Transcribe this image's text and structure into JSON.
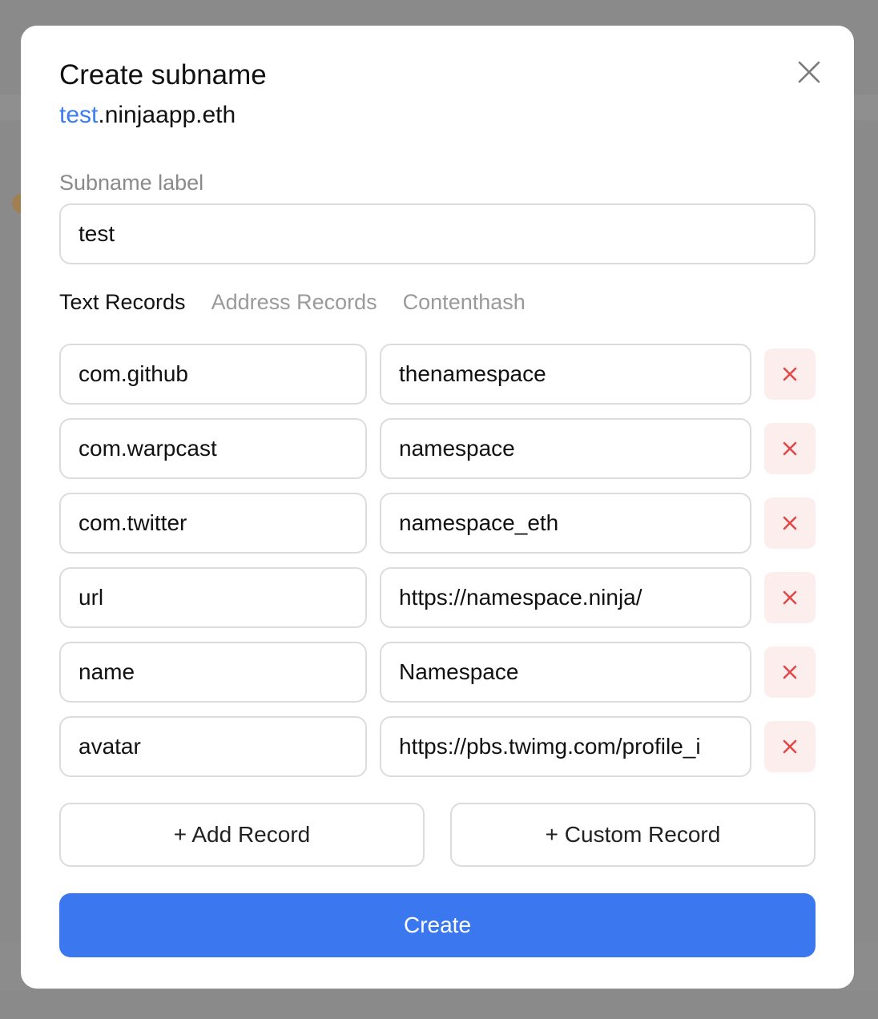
{
  "modal": {
    "title": "Create subname",
    "subtitle_label": "test",
    "subtitle_domain": ".ninjaapp.eth"
  },
  "subname": {
    "field_label": "Subname label",
    "value": "test"
  },
  "tabs": [
    {
      "label": "Text Records",
      "active": true
    },
    {
      "label": "Address Records",
      "active": false
    },
    {
      "label": "Contenthash",
      "active": false
    }
  ],
  "records": [
    {
      "key": "com.github",
      "value": "thenamespace"
    },
    {
      "key": "com.warpcast",
      "value": "namespace"
    },
    {
      "key": "com.twitter",
      "value": "namespace_eth"
    },
    {
      "key": "url",
      "value": "https://namespace.ninja/"
    },
    {
      "key": "name",
      "value": "Namespace"
    },
    {
      "key": "avatar",
      "value": "https://pbs.twimg.com/profile_i"
    }
  ],
  "actions": {
    "add_record": "+ Add Record",
    "custom_record": "+ Custom Record",
    "create": "Create"
  },
  "colors": {
    "accent": "#3b78f0",
    "delete_bg": "#fdeeee",
    "delete_icon": "#e04848"
  },
  "icons": {
    "close": "close-icon",
    "delete": "x-icon"
  }
}
